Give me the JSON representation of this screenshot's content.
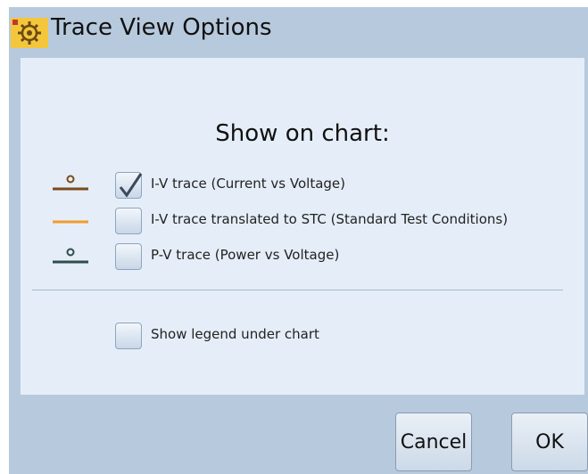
{
  "window": {
    "title": "Trace View Options",
    "app_icon": "gear-icon",
    "background_color": "#b7c9dd",
    "panel_color": "#e5eef8"
  },
  "dialog": {
    "heading": "Show on chart:",
    "trace_options": [
      {
        "label": "I-V trace (Current vs Voltage)",
        "checked": true,
        "swatch": "line-with-circle",
        "swatch_color": "#7a4a1c"
      },
      {
        "label": "I-V trace translated to STC (Standard Test Conditions)",
        "checked": false,
        "swatch": "line",
        "swatch_color": "#f39c2b"
      },
      {
        "label": "P-V trace (Power vs Voltage)",
        "checked": false,
        "swatch": "line-with-circle",
        "swatch_color": "#2f4d4a"
      }
    ],
    "legend_option": {
      "label": "Show legend under chart",
      "checked": false
    }
  },
  "buttons": {
    "cancel": "Cancel",
    "ok": "OK"
  }
}
